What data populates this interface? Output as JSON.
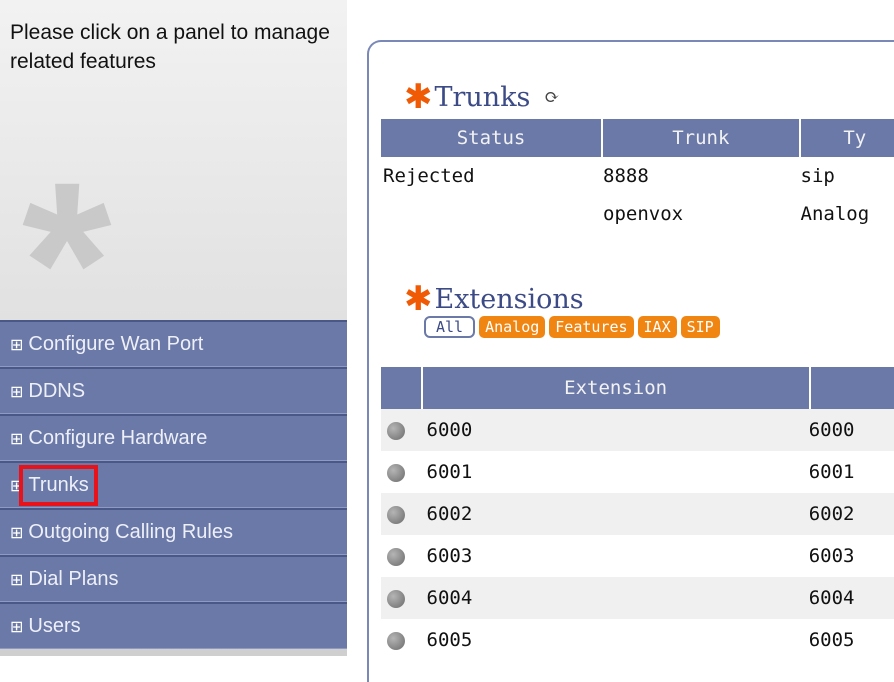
{
  "sidebar": {
    "intro_text": "Please click on a panel to manage related features",
    "grip_glyph": "⊞",
    "items": [
      {
        "label": "Configure Wan Port"
      },
      {
        "label": "DDNS"
      },
      {
        "label": "Configure Hardware"
      },
      {
        "label": "Trunks",
        "selected": true
      },
      {
        "label": "Outgoing Calling Rules"
      },
      {
        "label": "Dial Plans"
      },
      {
        "label": "Users"
      }
    ]
  },
  "trunks": {
    "title": "Trunks",
    "columns": [
      "Status",
      "Trunk",
      "Ty"
    ],
    "rows": [
      {
        "status": "Rejected",
        "trunk": "8888",
        "type": "sip"
      },
      {
        "status": "",
        "trunk": "openvox",
        "type": "Analog"
      }
    ]
  },
  "extensions": {
    "title": "Extensions",
    "filters": [
      "All",
      "Analog",
      "Features",
      "IAX",
      "SIP"
    ],
    "columns": [
      "",
      "Extension",
      ""
    ],
    "rows": [
      {
        "extension": "6000",
        "second": "6000"
      },
      {
        "extension": "6001",
        "second": "6001"
      },
      {
        "extension": "6002",
        "second": "6002"
      },
      {
        "extension": "6003",
        "second": "6003"
      },
      {
        "extension": "6004",
        "second": "6004"
      },
      {
        "extension": "6005",
        "second": "6005"
      }
    ]
  },
  "colors": {
    "accent": "#6b79a9",
    "star": "#f15a05",
    "filter": "#f08512",
    "rejected": "#e4161a",
    "highlight": "#e8121b"
  }
}
